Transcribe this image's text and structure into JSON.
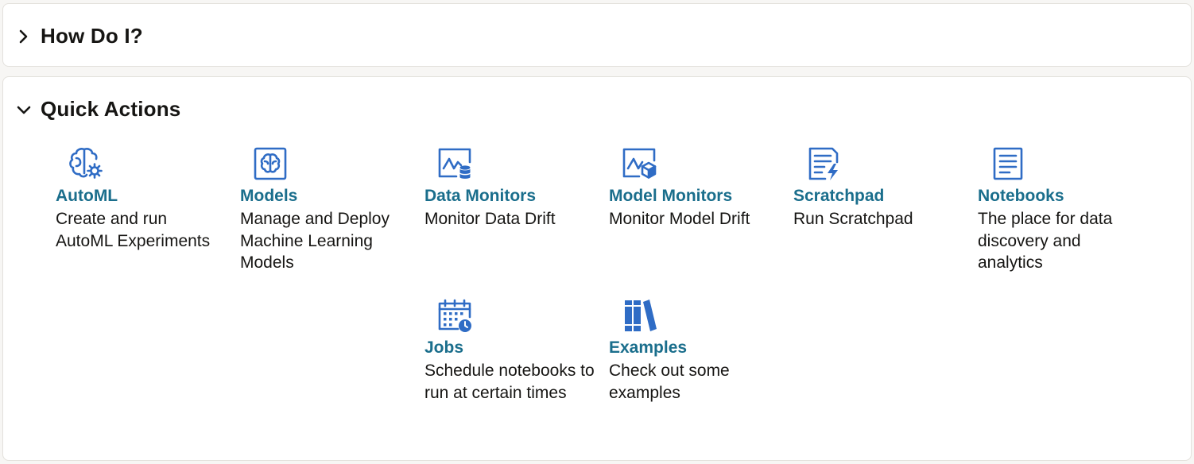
{
  "how_do_i": {
    "title": "How Do I?",
    "expanded": false,
    "icon": "chevron-right-icon"
  },
  "quick_actions": {
    "title": "Quick Actions",
    "expanded": true,
    "icon": "chevron-down-icon",
    "accent_color": "#1a6e8c",
    "icon_color": "#2f6cc5",
    "items": [
      {
        "title": "AutoML",
        "description": "Create and run AutoML Experiments",
        "icon": "brain-gear-icon"
      },
      {
        "title": "Models",
        "description": "Manage and Deploy Machine Learning Models",
        "icon": "model-brain-icon"
      },
      {
        "title": "Data Monitors",
        "description": "Monitor Data Drift",
        "icon": "chart-database-icon"
      },
      {
        "title": "Model Monitors",
        "description": "Monitor Model Drift",
        "icon": "chart-cube-icon"
      },
      {
        "title": "Scratchpad",
        "description": "Run Scratchpad",
        "icon": "document-bolt-icon"
      },
      {
        "title": "Notebooks",
        "description": "The place for data discovery and analytics",
        "icon": "notebook-icon"
      },
      {
        "title": "Jobs",
        "description": "Schedule notebooks to run at certain times",
        "icon": "calendar-clock-icon"
      },
      {
        "title": "Examples",
        "description": "Check out some examples",
        "icon": "library-books-icon"
      }
    ]
  }
}
